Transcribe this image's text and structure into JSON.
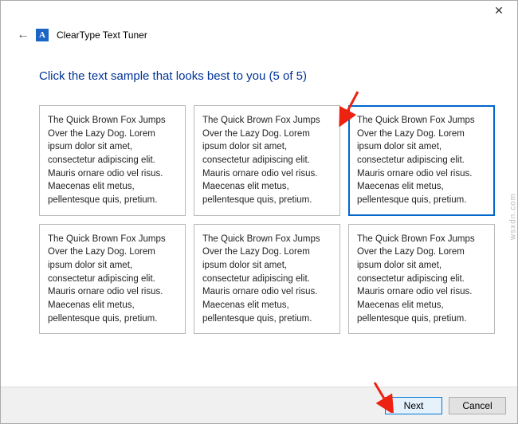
{
  "window": {
    "close_glyph": "✕",
    "back_glyph": "←",
    "app_icon_letter": "A",
    "title": "ClearType Text Tuner"
  },
  "heading": "Click the text sample that looks best to you (5 of 5)",
  "sample_text": "The Quick Brown Fox Jumps Over the Lazy Dog. Lorem ipsum dolor sit amet, consectetur adipiscing elit. Mauris ornare odio vel risus. Maecenas elit metus, pellentesque quis, pretium.",
  "selected_index": 2,
  "footer": {
    "next_label": "Next",
    "cancel_label": "Cancel"
  },
  "watermark": "wsxdn.com"
}
